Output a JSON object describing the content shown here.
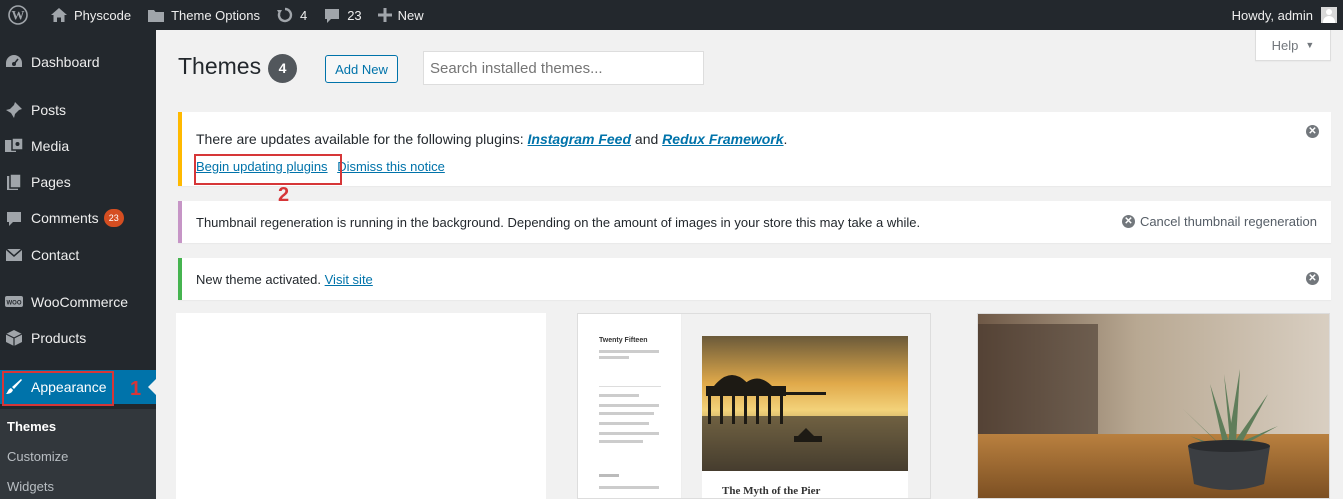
{
  "adminbar": {
    "site_name": "Physcode",
    "theme_options": "Theme Options",
    "updates_count": "4",
    "comments_count": "23",
    "new_label": "New",
    "howdy": "Howdy, admin"
  },
  "sidebar": {
    "items": [
      {
        "label": "Dashboard",
        "icon": "dashboard-icon"
      },
      {
        "label": "Posts",
        "icon": "pin-icon"
      },
      {
        "label": "Media",
        "icon": "media-icon"
      },
      {
        "label": "Pages",
        "icon": "pages-icon"
      },
      {
        "label": "Comments",
        "icon": "comment-icon",
        "badge": "23"
      },
      {
        "label": "Contact",
        "icon": "mail-icon"
      },
      {
        "label": "WooCommerce",
        "icon": "woocommerce-icon"
      },
      {
        "label": "Products",
        "icon": "archive-icon"
      },
      {
        "label": "Appearance",
        "icon": "paintbrush-icon"
      }
    ],
    "submenu": [
      "Themes",
      "Customize",
      "Widgets"
    ]
  },
  "page": {
    "title": "Themes",
    "count": "4",
    "add_new": "Add New",
    "search_placeholder": "Search installed themes...",
    "help": "Help"
  },
  "notices": {
    "plugins": {
      "text_before": "There are updates available for the following plugins: ",
      "plugin1": "Instagram Feed",
      "and": " and ",
      "plugin2": "Redux Framework",
      "period": ".",
      "begin_link": "Begin updating plugins",
      "dismiss_link": "Dismiss this notice"
    },
    "thumbs": {
      "text": "Thumbnail regeneration is running in the background. Depending on the amount of images in your store this may take a while.",
      "cancel": "Cancel thumbnail regeneration"
    },
    "activated": {
      "text": "New theme activated. ",
      "link": "Visit site"
    }
  },
  "annotations": {
    "num1": "1",
    "num2": "2"
  },
  "themes": {
    "twentyfifteen": {
      "site_title": "Twenty Fifteen",
      "post_title": "The Myth of the Pier"
    }
  },
  "colors": {
    "accent": "#0073aa",
    "sidebar_bg": "#23282d",
    "annotation_red": "#d63638"
  }
}
